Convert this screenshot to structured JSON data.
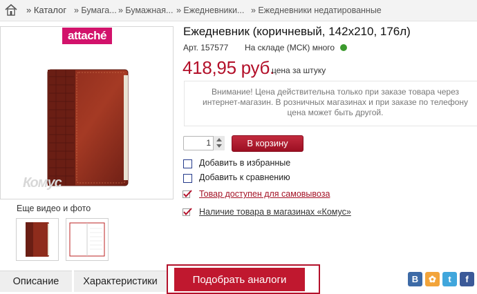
{
  "breadcrumb": {
    "items": [
      "» Каталог",
      "» Бумага...",
      "» Бумажная...",
      "» Ежедневники...",
      "» Ежедневники недатированные"
    ]
  },
  "product": {
    "title": "Ежедневник (коричневый, 142х210, 176л)",
    "article": "Арт. 157577",
    "stock": "На складе (МСК) много",
    "stock_color": "#3c9a2e",
    "price": "418,95 руб.",
    "price_unit": "цена за штуку",
    "price_color": "#b3102a",
    "brand": "attaché",
    "brand_color": "#d2126b",
    "watermark": "Комус",
    "notice": "Внимание! Цена действительна только при заказе товара через интернет-магазин. В розничных магазинах и при заказе по телефону цена может быть другой."
  },
  "gallery": {
    "more_label": "Еще видео и фото"
  },
  "order": {
    "quantity": "1",
    "cart_button": "В корзину"
  },
  "options": {
    "favorites": "Добавить в избранные",
    "compare": "Добавить к сравнению",
    "pickup": "Товар доступен для самовывоза",
    "stores": "Наличие товара в магазинах «Комус»"
  },
  "tabs": [
    {
      "label": "Описание"
    },
    {
      "label": "Характеристики"
    },
    {
      "label": "Подобрать аналоги",
      "active": true
    }
  ],
  "social": [
    {
      "name": "vk-icon",
      "glyph": "В",
      "color": "#3d6aa6"
    },
    {
      "name": "odnoklassniki-icon",
      "glyph": "✿",
      "color": "#f2a43a"
    },
    {
      "name": "twitter-icon",
      "glyph": "t",
      "color": "#40a6dc"
    },
    {
      "name": "facebook-icon",
      "glyph": "f",
      "color": "#3b5998"
    }
  ]
}
